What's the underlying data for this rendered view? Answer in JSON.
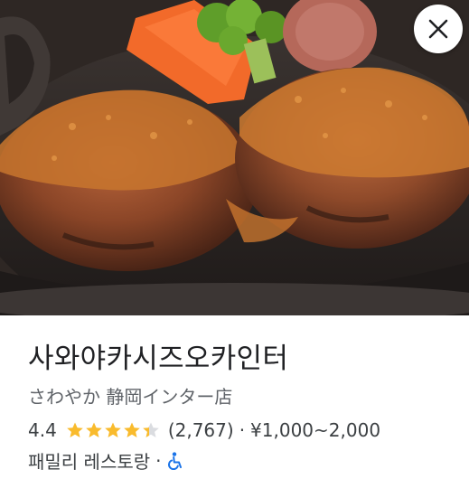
{
  "place": {
    "name": "사와야카시즈오카인터",
    "original_name": "さわやか 静岡インター店",
    "rating": "4.4",
    "stars_value": 4.4,
    "reviews": "(2,767)",
    "price_range": "¥1,000~2,000",
    "separator": "·",
    "category": "패밀리 레스토랑",
    "accessibility_icon": "wheelchair-icon"
  },
  "colors": {
    "star": "#f9bb2d",
    "accessibility": "#1a73e8",
    "title": "#202124",
    "secondary": "#5f6368"
  }
}
